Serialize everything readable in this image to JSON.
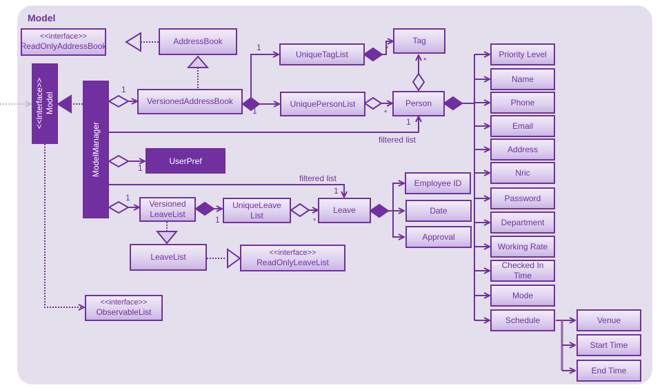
{
  "diagram": {
    "title": "Model",
    "colors": {
      "accent": "#7030a0",
      "background": "#e4dfec",
      "box_fill_top": "#f1ecf7",
      "box_fill_bottom": "#cbb6e4"
    },
    "classes": {
      "read_only_address_book": {
        "stereotype": "<<interface>>",
        "name": "ReadOnlyAddressBook"
      },
      "address_book": {
        "name": "AddressBook"
      },
      "model": {
        "stereotype": "<<interface>>",
        "name": "Model"
      },
      "model_manager": {
        "name": "ModelManager"
      },
      "versioned_address_book": {
        "name": "VersionedAddressBook"
      },
      "unique_tag_list": {
        "name": "UniqueTagList"
      },
      "unique_person_list": {
        "name": "UniquePersonList"
      },
      "tag": {
        "name": "Tag"
      },
      "person": {
        "name": "Person"
      },
      "user_pref": {
        "name": "UserPref"
      },
      "versioned_leave_list": {
        "name_line1": "Versioned",
        "name_line2": "LeaveList"
      },
      "unique_leave_list": {
        "name_line1": "UniqueLeave",
        "name_line2": "List"
      },
      "leave": {
        "name": "Leave"
      },
      "employee_id": {
        "name": "Employee ID"
      },
      "date": {
        "name": "Date"
      },
      "approval": {
        "name": "Approval"
      },
      "leave_list": {
        "name": "LeaveList"
      },
      "read_only_leave_list": {
        "stereotype": "<<interface>>",
        "name": "ReadOnlyLeaveList"
      },
      "observable_list": {
        "stereotype": "<<interface>>",
        "name": "ObservableList"
      }
    },
    "person_attributes": [
      {
        "name": "Priority Level"
      },
      {
        "name": "Name"
      },
      {
        "name": "Phone"
      },
      {
        "name": "Email"
      },
      {
        "name": "Address"
      },
      {
        "name": "Nric"
      },
      {
        "name": "Password"
      },
      {
        "name": "Department"
      },
      {
        "name": "Working Rate"
      },
      {
        "name": "Checked  In Time"
      },
      {
        "name": "Mode"
      },
      {
        "name": "Schedule"
      }
    ],
    "schedule_attributes": [
      {
        "name": "Venue"
      },
      {
        "name": "Start Time"
      },
      {
        "name": "End Time"
      }
    ],
    "labels": {
      "mult_one": "1",
      "mult_many": "*",
      "filtered_list": "filtered list"
    }
  }
}
